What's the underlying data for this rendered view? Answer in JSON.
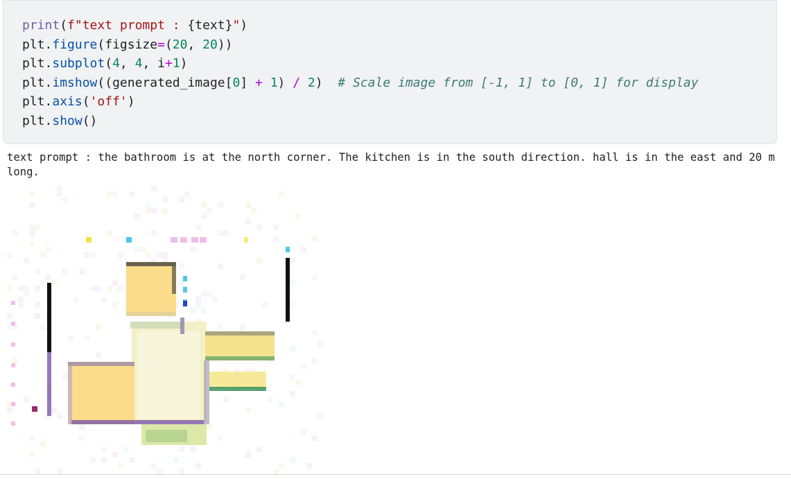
{
  "code_cell": {
    "lines": [
      {
        "tokens": [
          {
            "t": "print",
            "c": "fn"
          },
          {
            "t": "(",
            "c": "punc"
          },
          {
            "t": "f\"text prompt : ",
            "c": "str"
          },
          {
            "t": "{text}",
            "c": "id"
          },
          {
            "t": "\"",
            "c": "str"
          },
          {
            "t": ")",
            "c": "punc"
          }
        ]
      },
      {
        "tokens": [
          {
            "t": "plt",
            "c": "id"
          },
          {
            "t": ".",
            "c": "punc"
          },
          {
            "t": "figure",
            "c": "attr"
          },
          {
            "t": "(",
            "c": "punc"
          },
          {
            "t": "figsize",
            "c": "id"
          },
          {
            "t": "=",
            "c": "op"
          },
          {
            "t": "(",
            "c": "punc"
          },
          {
            "t": "20",
            "c": "num"
          },
          {
            "t": ", ",
            "c": "punc"
          },
          {
            "t": "20",
            "c": "num"
          },
          {
            "t": "))",
            "c": "punc"
          }
        ]
      },
      {
        "tokens": [
          {
            "t": "plt",
            "c": "id"
          },
          {
            "t": ".",
            "c": "punc"
          },
          {
            "t": "subplot",
            "c": "attr"
          },
          {
            "t": "(",
            "c": "punc"
          },
          {
            "t": "4",
            "c": "num"
          },
          {
            "t": ", ",
            "c": "punc"
          },
          {
            "t": "4",
            "c": "num"
          },
          {
            "t": ", ",
            "c": "punc"
          },
          {
            "t": "i",
            "c": "id"
          },
          {
            "t": "+",
            "c": "op"
          },
          {
            "t": "1",
            "c": "num"
          },
          {
            "t": ")",
            "c": "punc"
          }
        ]
      },
      {
        "tokens": [
          {
            "t": "plt",
            "c": "id"
          },
          {
            "t": ".",
            "c": "punc"
          },
          {
            "t": "imshow",
            "c": "attr"
          },
          {
            "t": "((",
            "c": "punc"
          },
          {
            "t": "generated_image",
            "c": "id"
          },
          {
            "t": "[",
            "c": "punc"
          },
          {
            "t": "0",
            "c": "num"
          },
          {
            "t": "] ",
            "c": "punc"
          },
          {
            "t": "+",
            "c": "op"
          },
          {
            "t": " ",
            "c": "punc"
          },
          {
            "t": "1",
            "c": "num"
          },
          {
            "t": ") ",
            "c": "punc"
          },
          {
            "t": "/",
            "c": "op"
          },
          {
            "t": " ",
            "c": "punc"
          },
          {
            "t": "2",
            "c": "num"
          },
          {
            "t": ")  ",
            "c": "punc"
          },
          {
            "t": "# Scale image from [-1, 1] to [0, 1] for display",
            "c": "comment"
          }
        ]
      },
      {
        "tokens": [
          {
            "t": "plt",
            "c": "id"
          },
          {
            "t": ".",
            "c": "punc"
          },
          {
            "t": "axis",
            "c": "attr"
          },
          {
            "t": "(",
            "c": "punc"
          },
          {
            "t": "'off'",
            "c": "str"
          },
          {
            "t": ")",
            "c": "punc"
          }
        ]
      },
      {
        "tokens": [
          {
            "t": "plt",
            "c": "id"
          },
          {
            "t": ".",
            "c": "punc"
          },
          {
            "t": "show",
            "c": "attr"
          },
          {
            "t": "()",
            "c": "punc"
          }
        ]
      }
    ]
  },
  "output": {
    "text": "text prompt : the bathroom is at the north corner. The kitchen is in the south direction. hall is in the east and 20 m long."
  },
  "figure": {
    "description_icon": "generated-floorplan-image",
    "colors": {
      "room_fill": "#fbdc8a",
      "room_center": "#f3f0c8",
      "wall_dark": "#3a3a3a",
      "wall_purple": "#7a56a8",
      "accent_green": "#2f8a55",
      "accent_cyan": "#4fc8e8",
      "accent_blue": "#2244cc",
      "speck_pink": "#f2bde6",
      "speck_yellow": "#f6e24a"
    }
  }
}
